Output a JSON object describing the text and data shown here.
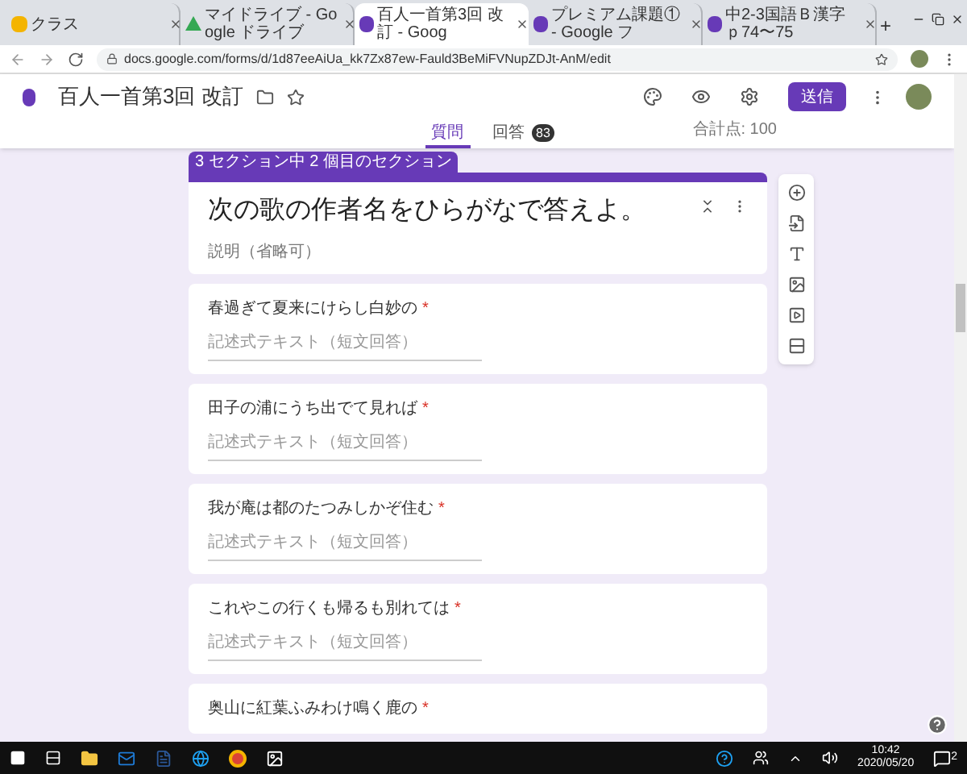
{
  "browser": {
    "tabs": [
      {
        "title": "クラス",
        "selected": false,
        "kind": "classroom"
      },
      {
        "title": "マイドライブ - Google ドライブ",
        "selected": false,
        "kind": "drive"
      },
      {
        "title": "百人一首第3回 改訂 - Goog",
        "selected": true,
        "kind": "forms"
      },
      {
        "title": "プレミアム課題① - Google フ",
        "selected": false,
        "kind": "forms"
      },
      {
        "title": "中2-3国語Ｂ漢字ｐ74〜75",
        "selected": false,
        "kind": "forms"
      }
    ],
    "new_tab": "+",
    "url": "docs.google.com/forms/d/1d87eeAiUa_kk7Zx87ew-Fauld3BeMiFVNupZDJt-AnM/edit"
  },
  "form": {
    "title": "百人一首第3回 改訂",
    "send_button": "送信",
    "starred": false,
    "tabs": [
      {
        "label": "質問",
        "selected": true
      },
      {
        "label": "回答",
        "selected": false,
        "badge": "83"
      }
    ],
    "total_points": "合計点: 100"
  },
  "section_label": "3 セクション中 2 個目のセクション",
  "section": {
    "title": "次の歌の作者名をひらがなで答えよ。",
    "description": "説明（省略可）"
  },
  "questions": [
    {
      "label": "春過ぎて夏来にけらし白妙の",
      "required": true,
      "placeholder": "記述式テキスト（短文回答）"
    },
    {
      "label": "田子の浦にうち出でて見れば",
      "required": true,
      "placeholder": "記述式テキスト（短文回答）"
    },
    {
      "label": "我が庵は都のたつみしかぞ住む",
      "required": true,
      "placeholder": "記述式テキスト（短文回答）"
    },
    {
      "label": "これやこの行くも帰るも別れては",
      "required": true,
      "placeholder": "記述式テキスト（短文回答）"
    },
    {
      "label": "奥山に紅葉ふみわけ鳴く鹿の",
      "required": true
    }
  ],
  "required_mark": "*",
  "taskbar": {
    "time": "10:42",
    "date": "2020/05/20",
    "notifications": "2"
  }
}
